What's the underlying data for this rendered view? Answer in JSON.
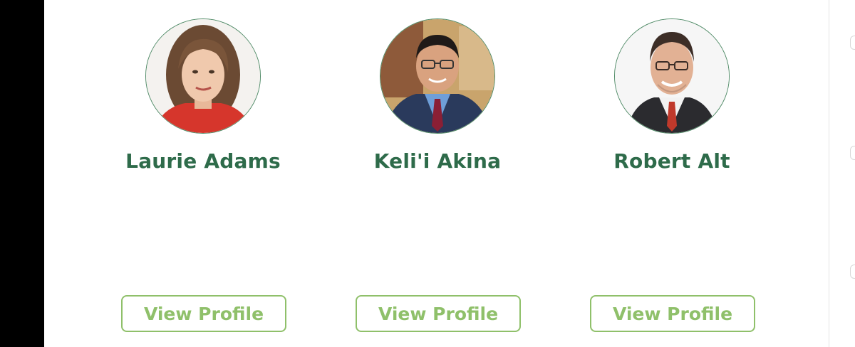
{
  "people": [
    {
      "name": "Laurie Adams",
      "button_label": "View Profile"
    },
    {
      "name": "Keli'i Akina",
      "button_label": "View Profile"
    },
    {
      "name": "Robert Alt",
      "button_label": "View Profile"
    }
  ],
  "colors": {
    "name_text": "#2e6b4a",
    "button_accent": "#8fc06a",
    "avatar_border": "#4f8a66"
  }
}
